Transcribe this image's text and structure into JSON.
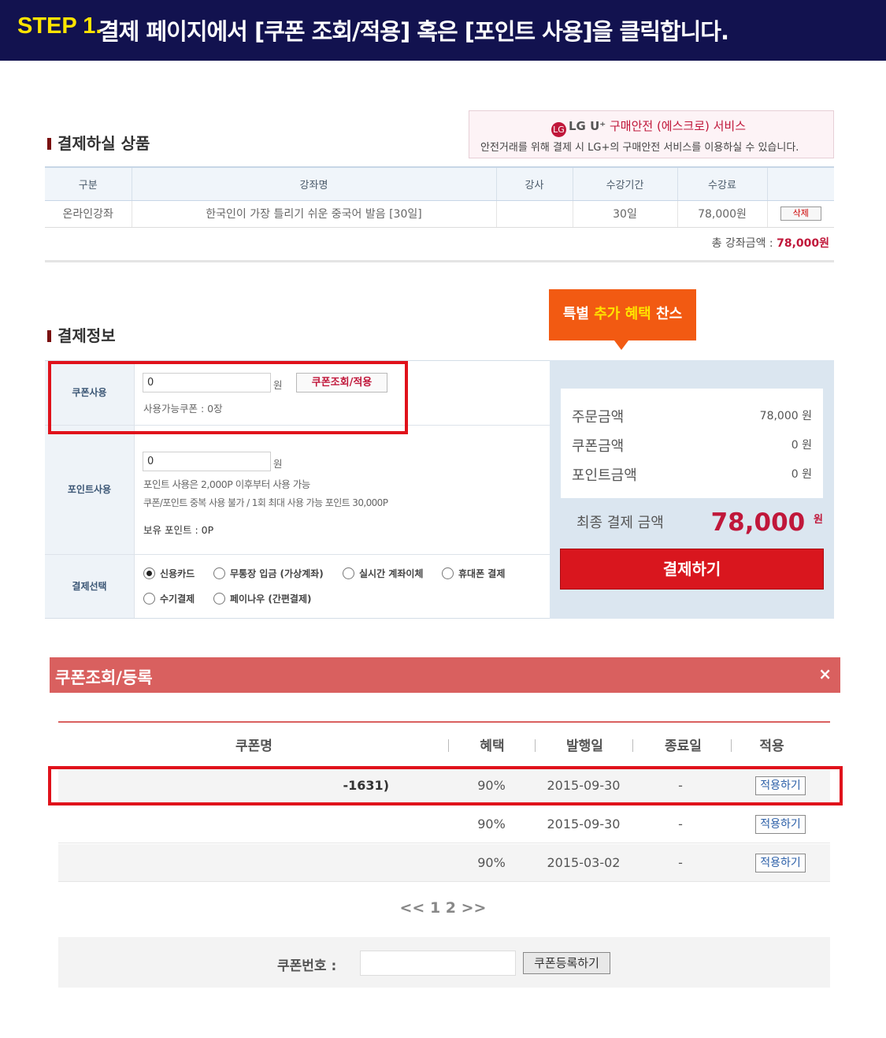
{
  "banner": {
    "step": "STEP 1.",
    "title": "결제 페이지에서 [쿠폰 조회/적용] 혹은 [포인트 사용]을 클릭합니다."
  },
  "products": {
    "section_title": "결제하실 상품",
    "lg": {
      "logo": "LG",
      "brand": "LG U⁺",
      "service": "구매안전 (에스크로) 서비스",
      "desc": "안전거래를 위해 결제 시 LG+의 구매안전 서비스를 이용하실 수 있습니다."
    },
    "headers": [
      "구분",
      "강좌명",
      "강사",
      "수강기간",
      "수강료",
      ""
    ],
    "row": {
      "type": "온라인강좌",
      "name": "한국인이 가장 틀리기 쉬운 중국어 발음 [30일]",
      "teacher": "",
      "period": "30일",
      "price": "78,000원",
      "delete": "삭제"
    },
    "total_label": "총 강좌금액 : ",
    "total_value": "78,000원"
  },
  "payment": {
    "section_title": "결제정보",
    "special": {
      "a": "특별 ",
      "b": "추가 혜택",
      "c": " 찬스"
    },
    "coupon": {
      "label": "쿠폰사용",
      "value": "0",
      "unit": "원",
      "button": "쿠폰조회/적용",
      "available": "사용가능쿠폰 : 0장"
    },
    "point": {
      "label": "포인트사용",
      "value": "0",
      "unit": "원",
      "note1": "포인트 사용은 2,000P 이후부터 사용 가능",
      "note2": "쿠폰/포인트 중복 사용 불가 / 1회 최대 사용 가능 포인트 30,000P",
      "owned": "보유 포인트 : 0P"
    },
    "method": {
      "label": "결제선택",
      "options": [
        "신용카드",
        "무통장 입금 (가상계좌)",
        "실시간 계좌이체",
        "휴대폰 결제",
        "수기결제",
        "페이나우 (간편결제)"
      ],
      "selected": "신용카드"
    },
    "summary": {
      "order_label": "주문금액",
      "order_value": "78,000 원",
      "coupon_label": "쿠폰금액",
      "coupon_value": "0 원",
      "point_label": "포인트금액",
      "point_value": "0 원",
      "final_label": "최종 결제 금액",
      "final_value": "78,000",
      "final_unit": "원",
      "pay_button": "결제하기"
    }
  },
  "popup": {
    "title": "쿠폰조회/등록",
    "close": "×",
    "headers": [
      "쿠폰명",
      "혜택",
      "발행일",
      "종료일",
      "적용"
    ],
    "rows": [
      {
        "name": "-1631)",
        "benefit": "90%",
        "issued": "2015-09-30",
        "end": "-",
        "apply": "적용하기"
      },
      {
        "name": "",
        "benefit": "90%",
        "issued": "2015-09-30",
        "end": "-",
        "apply": "적용하기"
      },
      {
        "name": "",
        "benefit": "90%",
        "issued": "2015-03-02",
        "end": "-",
        "apply": "적용하기"
      }
    ],
    "pager": "<< 1 2 >>",
    "register_label": "쿠폰번호 :",
    "register_button": "쿠폰등록하기"
  },
  "colors": {
    "banner": "#12124f",
    "step": "#ffe400",
    "accent": "#c0173a",
    "highlight": "#e0121b",
    "popup_header": "#d9605f"
  }
}
